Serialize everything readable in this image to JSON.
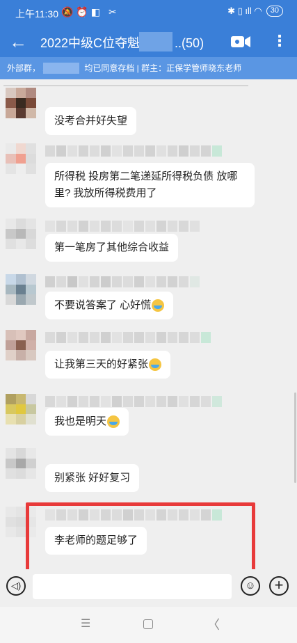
{
  "status_bar": {
    "time": "上午11:30",
    "left_icons": "🔕⏰◧ ✂",
    "right_icons": "✱ ▯ ıll ◠",
    "battery": "30"
  },
  "header": {
    "title": "2022中级C位夺魁会",
    "title_tail": "..(50)",
    "back_icon": "←",
    "video_icon": "video-call-icon",
    "more_icon": "⋮"
  },
  "notice": {
    "text": "外部群，          邪联系人，均已同意存档 | 群主：正保学管师晓东老师"
  },
  "messages": [
    {
      "text": "没考合并好失望",
      "emoji": false
    },
    {
      "text": "所得税 投房第二笔递延所得税负债 放哪里? 我放所得税费用了",
      "emoji": false
    },
    {
      "text": "第一笔房了其他综合收益",
      "emoji": false
    },
    {
      "text": "不要说答案了 心好慌",
      "emoji": true
    },
    {
      "text": "让我第三天的好紧张",
      "emoji": true
    },
    {
      "text": "我也是明天",
      "emoji": true
    },
    {
      "text": "别紧张 好好复习",
      "emoji": false
    },
    {
      "text": "李老师的题足够了",
      "emoji": false
    }
  ],
  "input_bar": {
    "voice_icon": "voice-icon",
    "emoji_icon": "emoji-icon",
    "plus_icon": "plus-icon",
    "voice_glyph": "◁)",
    "emoji_glyph": "☺",
    "plus_glyph": "+"
  },
  "nav_bar": {
    "menu": "☰",
    "back": "〈"
  },
  "colors": {
    "header": "#3a7fd8",
    "notice": "#5a96e3",
    "highlight": "#e83a3a",
    "background": "#efefef"
  }
}
